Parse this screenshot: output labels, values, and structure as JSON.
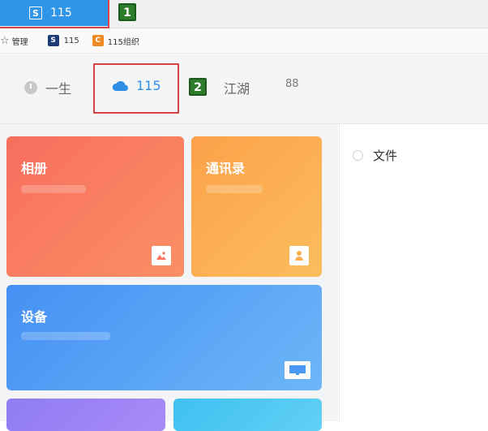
{
  "browser_tab": {
    "label": "115",
    "logo": "S"
  },
  "annotations": {
    "badge1": "1",
    "badge2": "2"
  },
  "bookmarks": [
    {
      "label": "管理",
      "icon": "star-icon"
    },
    {
      "label": "115",
      "icon": "115-logo-icon"
    },
    {
      "label": "115组织",
      "icon": "org-logo-icon"
    }
  ],
  "nav": {
    "life": "一生",
    "cloud": "115",
    "jianghu": "江湖",
    "apps_glyph": "88"
  },
  "cards": {
    "album": "相册",
    "contacts": "通讯录",
    "device": "设备"
  },
  "right_panel": {
    "file_option": "文件"
  },
  "colors": {
    "accent_blue": "#2f95e8",
    "album": "#f8735f",
    "contacts": "#fbb04c",
    "device": "#4a9af5",
    "highlight_red": "#d64545"
  }
}
